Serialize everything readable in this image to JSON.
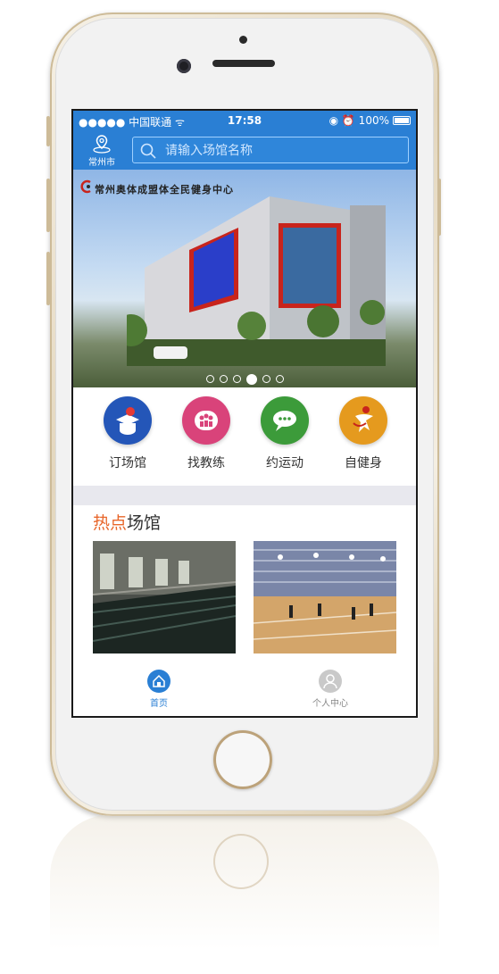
{
  "status_bar": {
    "carrier": "●●●●● 中国联通 ᯤ",
    "time": "17:58",
    "right": "◉ ⏰ 100%"
  },
  "header": {
    "city_icon": "location-pin-icon",
    "city": "常州市",
    "search_placeholder": "请输入场馆名称",
    "search_icon": "search-icon"
  },
  "banner": {
    "title": "常州奥体成盟体全民健身中心",
    "slide_count": 6,
    "active_index": 3
  },
  "categories": [
    {
      "label": "订场馆",
      "icon": "venue-booking-icon",
      "color": "#2456b8"
    },
    {
      "label": "找教练",
      "icon": "coach-icon",
      "color": "#d9437a"
    },
    {
      "label": "约运动",
      "icon": "chat-icon",
      "color": "#3c9b3a"
    },
    {
      "label": "自健身",
      "icon": "fitness-icon",
      "color": "#e59a1e"
    }
  ],
  "hot_section": {
    "title_highlight": "热点",
    "title_rest": "场馆",
    "venues": [
      {
        "name": "swimming-pool-photo"
      },
      {
        "name": "badminton-hall-photo"
      }
    ]
  },
  "tab_bar": {
    "items": [
      {
        "label": "首页",
        "icon": "home-icon",
        "active": true
      },
      {
        "label": "个人中心",
        "icon": "user-icon",
        "active": false
      }
    ],
    "active_color": "#2a7fd4",
    "inactive_color": "#888888"
  }
}
